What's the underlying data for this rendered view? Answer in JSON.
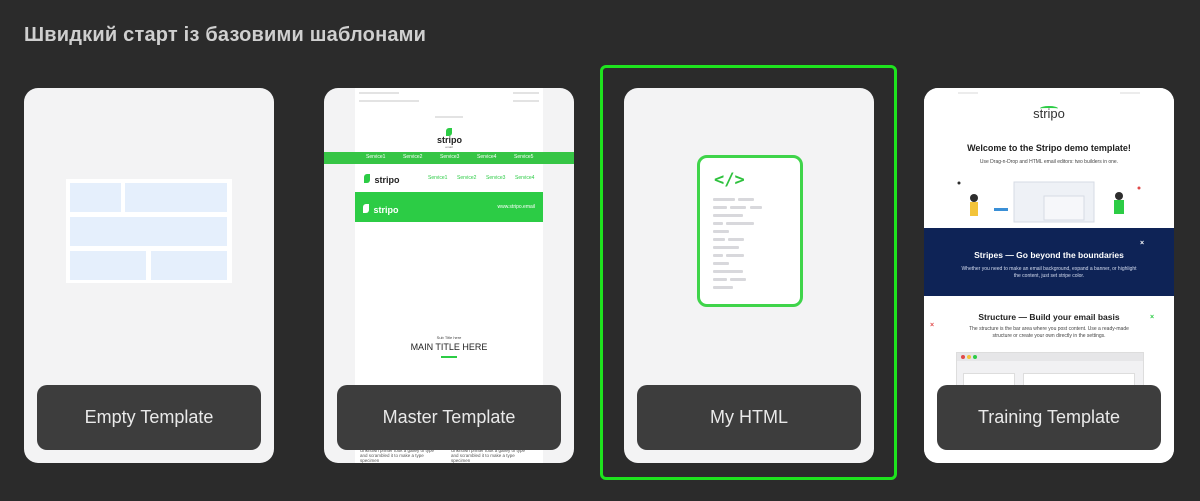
{
  "heading": "Швидкий старт із базовими шаблонами",
  "selected_color": "#1ee31e",
  "accent_green": "#2ccc45",
  "templates": [
    {
      "label": "Empty Template"
    },
    {
      "label": "Master Template",
      "preview": {
        "logo": "stripo",
        "logo_sub": "email",
        "nav": [
          "Service1",
          "Service2",
          "Service3",
          "Service4",
          "Service5"
        ],
        "menu": [
          "Service1",
          "Service2",
          "Service3",
          "Service4"
        ],
        "banner_text": "www.stripo.email",
        "subtitle": "Sub Title here",
        "title": "MAIN TITLE HERE",
        "footer_text": "Unknown printer took a galley of type and scrambled it to make a type specimen"
      }
    },
    {
      "label": "My HTML",
      "icon": "code-document-icon",
      "code_glyph": "</>"
    },
    {
      "label": "Training Template",
      "preview": {
        "logo": "stripo",
        "welcome_title": "Welcome to the Stripo demo template!",
        "welcome_text": "Use Drag-n-Drop and HTML email editors: two builders in one.",
        "stripes_title": "Stripes — Go beyond the boundaries",
        "stripes_text": "Whether you need to make an email background, expand a banner, or highlight the content, just set stripe color.",
        "structure_title": "Structure — Build your email basis",
        "structure_text": "The structure is the bar area where you post content. Use a ready-made structure or create your own directly in the settings."
      }
    }
  ]
}
